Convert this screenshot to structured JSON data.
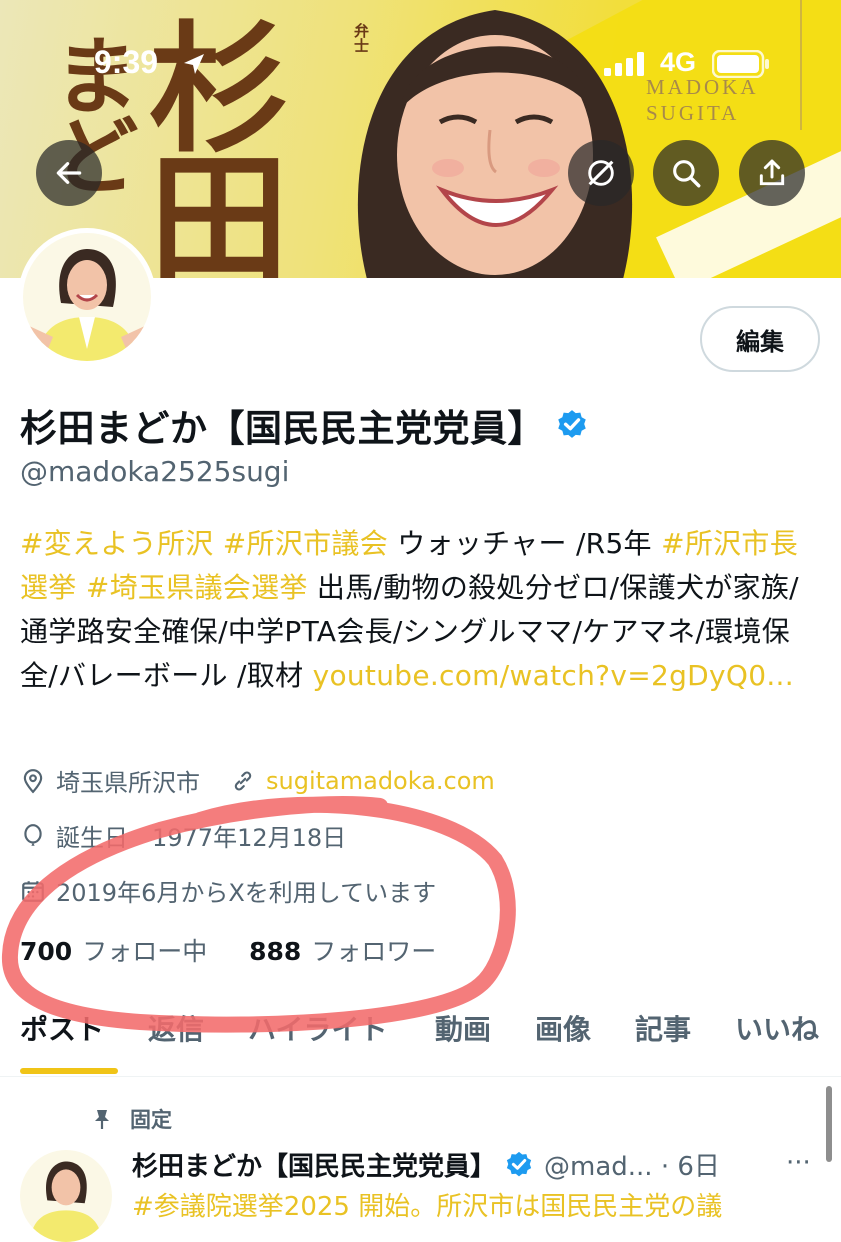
{
  "status_bar": {
    "time": "9:39",
    "network": "4G"
  },
  "banner": {
    "hiragana": "まど",
    "kanji": "杉田",
    "small": "弁士",
    "latin_line1": "MADOKA",
    "latin_line2": "SUGITA"
  },
  "header": {
    "back": "back-arrow",
    "icons": [
      "grok-icon",
      "search-icon",
      "share-icon"
    ]
  },
  "profile": {
    "edit_label": "編集",
    "name": "杉田まどか【国民民主党党員】",
    "handle": "@madoka2525sugi",
    "bio": {
      "tag1": "#変えよう所沢",
      "tag2": "#所沢市議会",
      "text1": " ウォッチャー /R5年 ",
      "tag3": "#所沢市長選挙",
      "tag4": "#埼玉県議会選挙",
      "text2": " 出馬/動物の殺処分ゼロ/保護犬が家族/通学路安全確保/中学PTA会長/シングルママ/ケアマネ/環境保全/バレーボール /取材 ",
      "link": "youtube.com/watch?v=2gDyQ0..."
    },
    "location": "埼玉県所沢市",
    "website": "sugitamadoka.com",
    "birthday": "誕生日　1977年12月18日",
    "joined": "2019年6月からXを利用しています",
    "following_count": "700",
    "following_label": "フォロー中",
    "followers_count": "888",
    "followers_label": "フォロワー"
  },
  "tabs": [
    "ポスト",
    "返信",
    "ハイライト",
    "動画",
    "画像",
    "記事",
    "いいね"
  ],
  "active_tab": "ポスト",
  "pinned_post": {
    "pinned_label": "固定",
    "author": "杉田まどか【国民民主党党員】",
    "handle_time": "@mad... · 6日",
    "more": "···",
    "text": "#参議院選挙2025 開始。所沢市は国民民主党の議"
  },
  "colors": {
    "accent": "#f0c417",
    "link": "#e9c224",
    "verified": "#1d9bf0",
    "annotation": "#f26b6b"
  }
}
